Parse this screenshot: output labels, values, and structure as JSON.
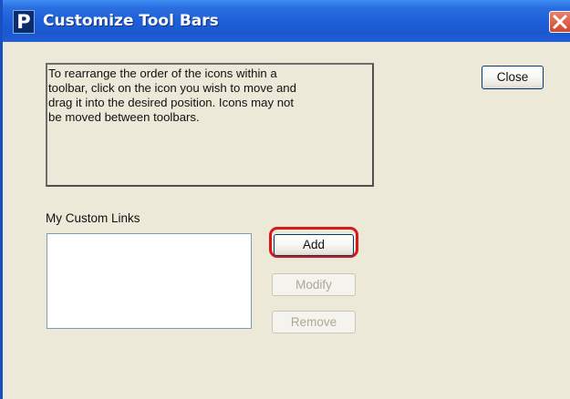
{
  "window": {
    "title": "Customize Tool Bars",
    "app_icon_letter": "P",
    "close_icon": "close-icon"
  },
  "instructions": {
    "text": "To rearrange the order of the icons within a\ntoolbar, click on the icon you wish to move and\ndrag it into the desired position. Icons may not\nbe moved between toolbars."
  },
  "buttons": {
    "close_label": "Close",
    "add_label": "Add",
    "modify_label": "Modify",
    "remove_label": "Remove"
  },
  "custom_links": {
    "label": "My Custom Links",
    "items": []
  },
  "colors": {
    "titlebar": "#1d5fd8",
    "highlight": "#d6171b",
    "dialog_background": "#ece9d8"
  }
}
